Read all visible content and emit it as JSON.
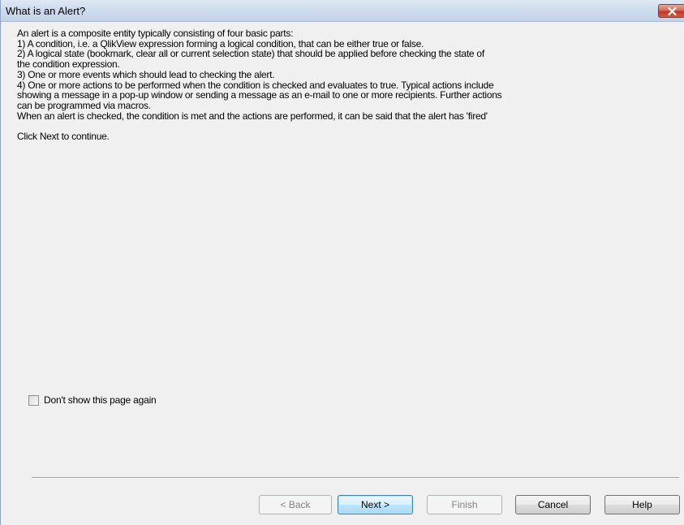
{
  "window": {
    "title": "What is an Alert?"
  },
  "body": {
    "lines": [
      "An alert is a composite entity typically consisting of four basic parts:",
      "1)  A condition, i.e. a QlikView expression forming a logical condition, that can be either true or false.",
      "2)  A logical state (bookmark, clear all or current selection state) that should be applied before checking the state of",
      "the condition expression.",
      "3)  One or more events which should lead to checking the alert.",
      "4)  One or more actions to be performed when the condition is checked and evaluates to true. Typical actions include",
      "showing a message in a pop-up window or sending a message as an e-mail to one or more recipients. Further actions",
      "can be programmed via macros.",
      "When an alert is checked, the condition is met and the actions are performed, it can be said that the alert has 'fired'"
    ],
    "continue_text": "Click Next to continue."
  },
  "checkbox": {
    "label": "Don't show this page again",
    "checked": false
  },
  "buttons": {
    "back": "< Back",
    "next": "Next >",
    "finish": "Finish",
    "cancel": "Cancel",
    "help": "Help"
  },
  "colors": {
    "title_bar": "#c9d9ec",
    "close_button": "#c0392b",
    "dialog_background": "#f0f0f0",
    "default_button_border": "#3c7fb1"
  }
}
